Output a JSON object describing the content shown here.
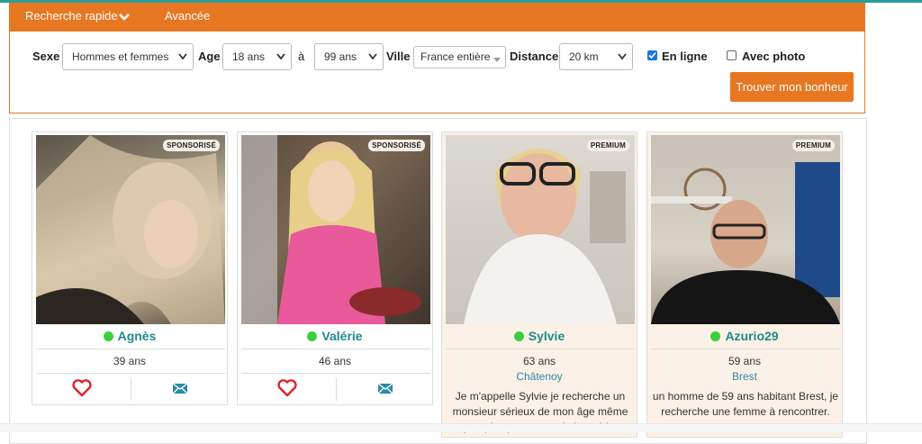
{
  "tabs": {
    "quick": "Recherche rapide",
    "advanced": "Avancée"
  },
  "search": {
    "sexe_label": "Sexe",
    "sexe_value": "Hommes et femmes",
    "age_label": "Age",
    "age_from": "18 ans",
    "age_sep": "à",
    "age_to": "99 ans",
    "ville_label": "Ville",
    "ville_value": "France entière",
    "distance_label": "Distance",
    "distance_value": "20 km",
    "online_label": "En ligne",
    "online_checked": true,
    "photo_label": "Avec photo",
    "photo_checked": false,
    "submit": "Trouver mon bonheur"
  },
  "colors": {
    "accent": "#e87722",
    "teal": "#1f8a8a",
    "online": "#3ccf3c",
    "heart": "#e0202a",
    "mail": "#2a8aa8"
  },
  "profiles": [
    {
      "badge": "SPONSORISÉ",
      "name": "Agnès",
      "age": "39 ans"
    },
    {
      "badge": "SPONSORISÉ",
      "name": "Valérie",
      "age": "46 ans"
    },
    {
      "badge": "PREMIUM",
      "name": "Sylvie",
      "age": "63 ans",
      "city": "Châtenoy",
      "desc": "Je m'appelle Sylvie je recherche un monsieur sérieux de mon âge même un peu plus pour une relation sérieuse"
    },
    {
      "badge": "PREMIUM",
      "name": "Azurio29",
      "age": "59 ans",
      "city": "Brest",
      "desc": "un homme de 59 ans habitant Brest, je recherche une femme à rencontrer."
    }
  ]
}
